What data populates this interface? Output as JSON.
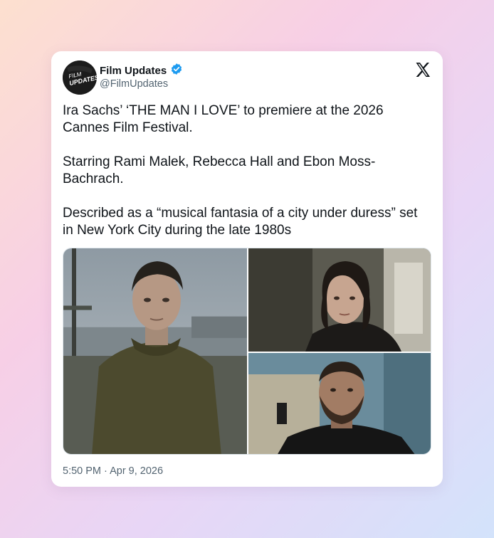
{
  "tweet": {
    "display_name": "Film Updates",
    "handle": "@FilmUpdates",
    "avatar_text_line1": "FILM",
    "avatar_text_line2": "UPDATES",
    "verified_icon": "verified-badge-icon",
    "platform_icon": "x-logo-icon",
    "paragraphs": [
      "Ira Sachs’ ‘THE MAN I LOVE’ to premiere at the 2026 Cannes Film Festival.",
      "Starring Rami Malek, Rebecca Hall and Ebon Moss-Bachrach.",
      "Described as a “musical fantasia of a city under duress” set in New York City during the late 1980s"
    ],
    "timestamp": "5:50 PM · Apr 9, 2026",
    "media_count": 3
  },
  "colors": {
    "verified_blue": "#1d9bf0",
    "text_primary": "#0f1419",
    "text_secondary": "#536471"
  }
}
